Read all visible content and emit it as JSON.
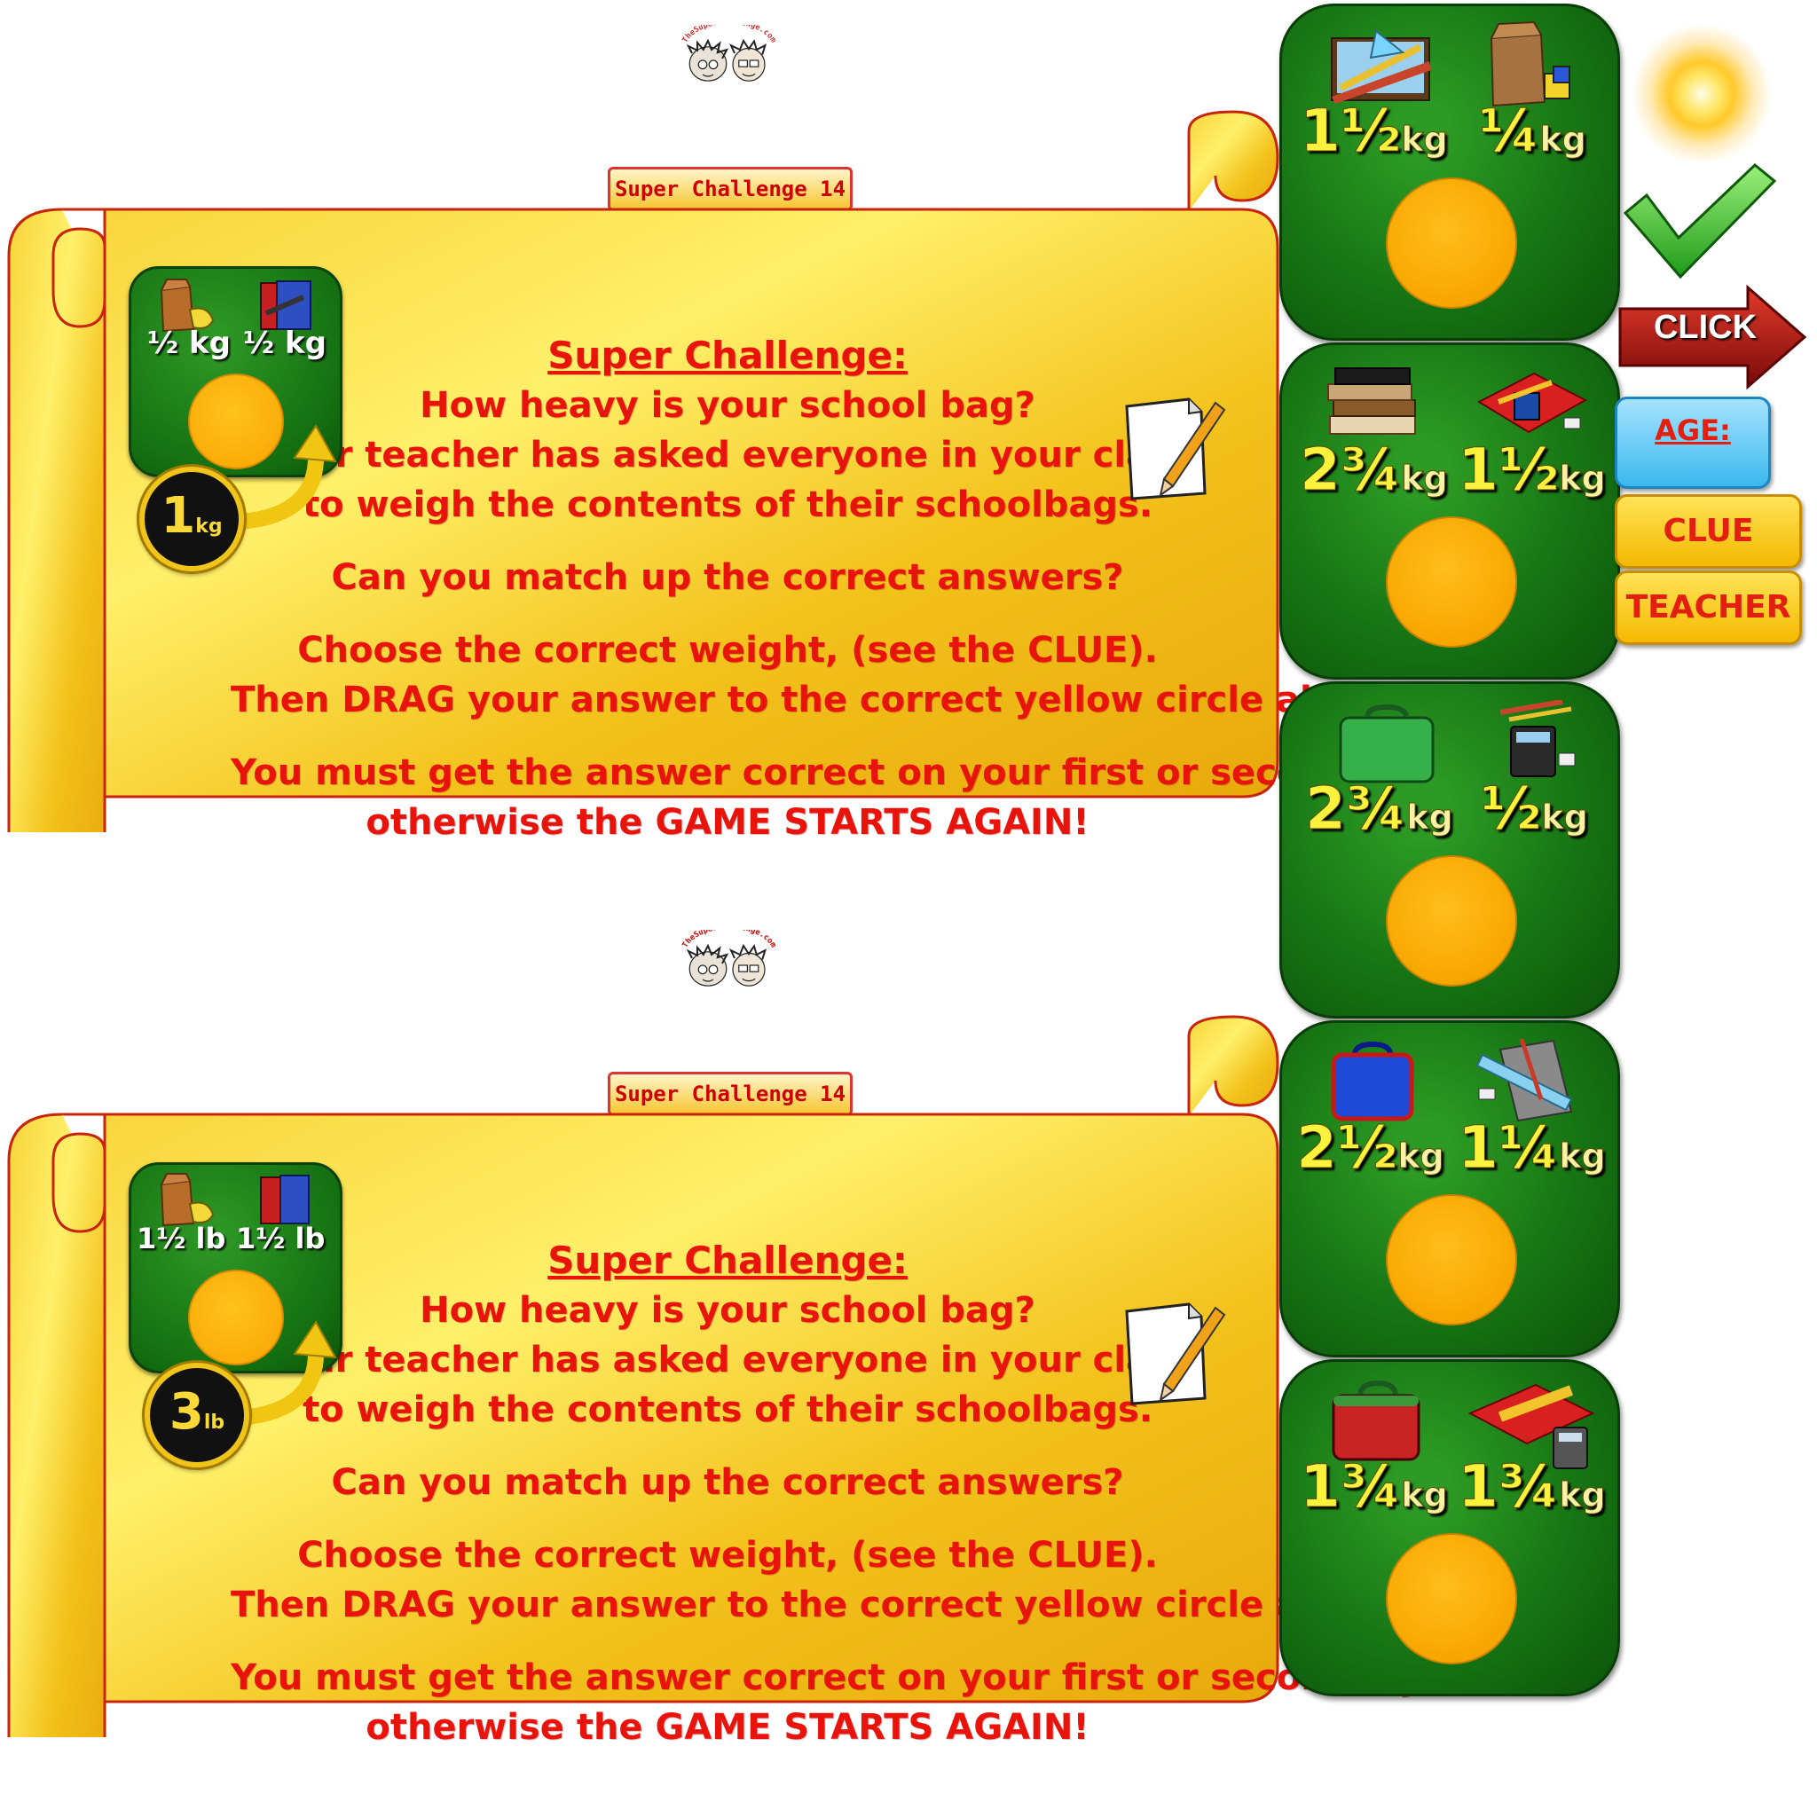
{
  "logo": {
    "site": "TheSuperChallenge.com",
    "badge": "Super Challenge 14"
  },
  "panels": [
    {
      "title": "Super Challenge:",
      "lines": [
        "How heavy is your school bag?",
        "Your teacher has asked everyone in your class",
        "to weigh the contents of their schoolbags.",
        "Can you match up the correct answers?",
        "Choose the correct weight, (see the CLUE).",
        "Then DRAG your answer to the correct yellow circle above.",
        "You must get the answer correct on your first or second try,",
        "otherwise the GAME STARTS AGAIN!"
      ],
      "example": {
        "left_label": "½ kg",
        "right_label": "½ kg",
        "left_item": "lunch-bag-icon",
        "right_item": "books-icon",
        "answer_number": "1",
        "answer_unit": "kg"
      }
    },
    {
      "title": "Super Challenge:",
      "lines": [
        "How heavy is your school bag?",
        "Your teacher has asked everyone in your class",
        "to weigh the contents of their schoolbags.",
        "Can you match up the correct answers?",
        "Choose the correct weight, (see the CLUE).",
        "Then DRAG your answer to the correct yellow circle above.",
        "You must get the answer correct on your first or second try,",
        "otherwise the GAME STARTS AGAIN!"
      ],
      "example": {
        "left_label": "1½ lb",
        "right_label": "1½ lb",
        "left_item": "lunch-bag-icon",
        "right_item": "books-icon",
        "answer_number": "3",
        "answer_unit": "lb"
      }
    }
  ],
  "tiles": [
    {
      "left_whole": "1",
      "left_frac": "½",
      "right_whole": "",
      "right_frac": "¼",
      "unit": "kg",
      "left_item": "stationery-set-icon",
      "right_item": "paper-bag-icon"
    },
    {
      "left_whole": "2",
      "left_frac": "¾",
      "right_whole": "1",
      "right_frac": "½",
      "unit": "kg",
      "left_item": "book-stack-icon",
      "right_item": "pencil-case-icon"
    },
    {
      "left_whole": "2",
      "left_frac": "¾",
      "right_whole": "",
      "right_frac": "½",
      "unit": "kg",
      "left_item": "green-lunchbox-icon",
      "right_item": "calculator-icon"
    },
    {
      "left_whole": "2",
      "left_frac": "½",
      "right_whole": "1",
      "right_frac": "¼",
      "unit": "kg",
      "left_item": "blue-lunchbox-icon",
      "right_item": "ruler-book-icon"
    },
    {
      "left_whole": "1",
      "left_frac": "¾",
      "right_whole": "1",
      "right_frac": "¾",
      "unit": "kg",
      "left_item": "red-lunchbox-icon",
      "right_item": "red-tray-icon"
    }
  ],
  "controls": {
    "click": "CLICK",
    "age": "AGE:",
    "clue": "CLUE",
    "teacher": "TEACHER"
  },
  "colors": {
    "scroll_gold": "#f5c319",
    "text_red": "#e8140c",
    "tile_green": "#167313",
    "drop_circle": "#f9a600",
    "label_yellow": "#fbf23e"
  }
}
